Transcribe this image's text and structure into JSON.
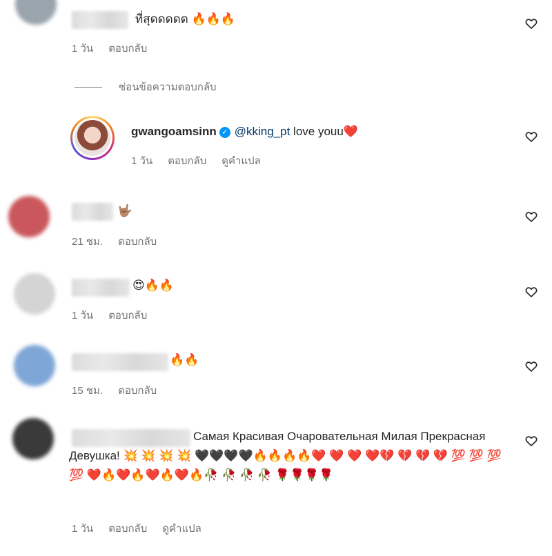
{
  "hidden_replies_label": "ซ่อนข้อความตอบกลับ",
  "comments": [
    {
      "text": "ที่สุดดดดด 🔥🔥🔥",
      "time": "1 วัน",
      "reply": "ตอบกลับ",
      "avatar_color": "#9aa4ad"
    },
    {
      "username": "gwangoamsinn",
      "mention": "@kking_pt",
      "text": " love youu❤️",
      "time": "1 วัน",
      "reply": "ตอบกลับ",
      "translate": "ดูคำแปล"
    },
    {
      "text": "🤟🏽",
      "time": "21 ชม.",
      "reply": "ตอบกลับ",
      "avatar_color": "#c9575b"
    },
    {
      "text": "😍🔥🔥",
      "time": "1 วัน",
      "reply": "ตอบกลับ",
      "avatar_color": "#d4d4d4"
    },
    {
      "text": "🔥🔥",
      "time": "15 ชม.",
      "reply": "ตอบกลับ",
      "avatar_color": "#7ea6d6"
    },
    {
      "text": "Самая Красивая Очаровательная Милая Прекрасная Девушка! 💥 💥 💥 💥 🖤🖤🖤🖤🔥🔥🔥🔥❤️ ❤️ ❤️ ❤️💔 💔 💔 💔 💯 💯 💯 💯 ❤️🔥❤️🔥❤️🔥❤️🔥🥀 🥀 🥀 🥀 🌹🌹🌹🌹",
      "time": "1 วัน",
      "reply": "ตอบกลับ",
      "translate": "ดูคำแปล",
      "avatar_color": "#3a3a3a"
    }
  ],
  "icons": {
    "like": "heart-outline-icon",
    "verified": "verified-badge-icon"
  },
  "colors": {
    "meta": "#737373",
    "mention": "#00376b",
    "verified": "#0095f6"
  }
}
